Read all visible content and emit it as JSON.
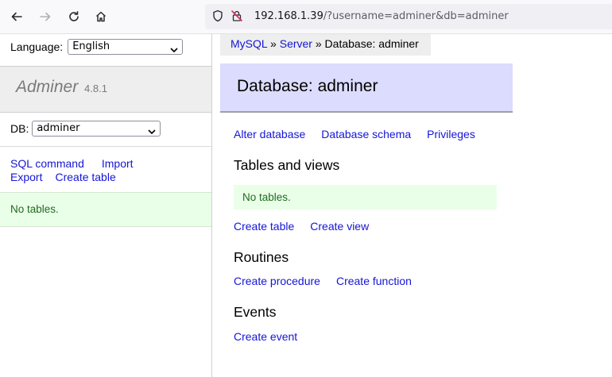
{
  "browser": {
    "url_host": "192.168.1.39",
    "url_path": "/?username=adminer&db=adminer",
    "icons": [
      "back-arrow-icon",
      "forward-arrow-icon",
      "reload-icon",
      "home-icon",
      "shield-icon",
      "insecure-lock-icon"
    ]
  },
  "menu": {
    "language_label": "Language:",
    "language_selected": "English",
    "app_name": "Adminer",
    "app_version": "4.8.1",
    "db_label": "DB:",
    "db_selected": "adminer",
    "links": {
      "sql_command": "SQL command",
      "import": "Import",
      "export": "Export",
      "create_table": "Create table"
    },
    "no_tables": "No tables."
  },
  "breadcrumb": {
    "mysql": "MySQL",
    "sep1": " » ",
    "server": "Server",
    "sep2": " » ",
    "current": "Database: adminer"
  },
  "content": {
    "title": "Database: adminer",
    "actions": {
      "alter_database": "Alter database",
      "database_schema": "Database schema",
      "privileges": "Privileges"
    },
    "tables_heading": "Tables and views",
    "no_tables": "No tables.",
    "create_table": "Create table",
    "create_view": "Create view",
    "routines_heading": "Routines",
    "create_procedure": "Create procedure",
    "create_function": "Create function",
    "events_heading": "Events",
    "create_event": "Create event"
  },
  "colors": {
    "link": "#1515d6",
    "header_bg": "#dcdcff",
    "message_bg": "#eaffe8",
    "message_text": "#1f6b1f"
  }
}
